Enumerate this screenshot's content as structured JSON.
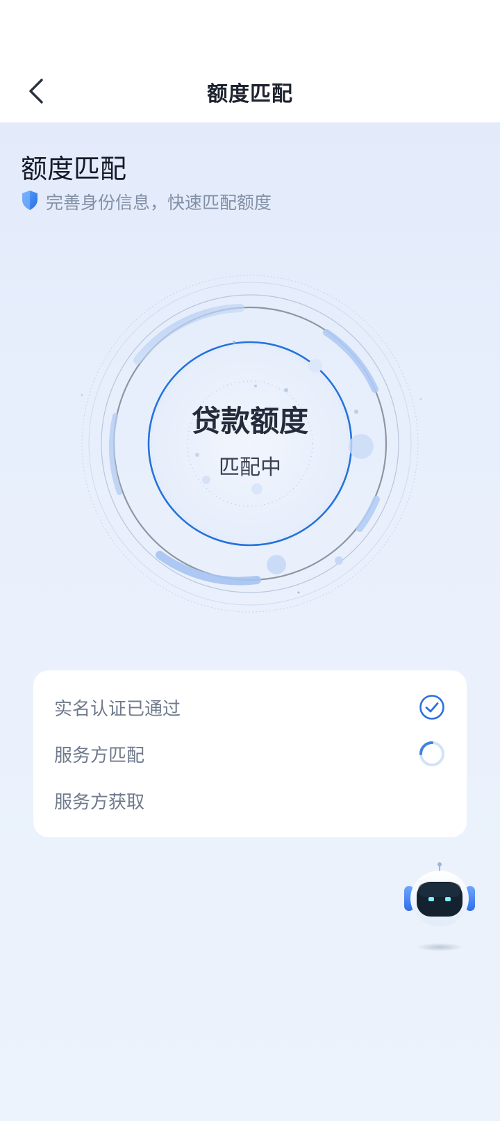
{
  "header": {
    "title": "额度匹配"
  },
  "main": {
    "heading": "额度匹配",
    "subtitle": "完善身份信息，快速匹配额度",
    "ring": {
      "title": "贷款额度",
      "status": "匹配中"
    },
    "steps": [
      {
        "label": "实名认证已通过",
        "state": "done"
      },
      {
        "label": "服务方匹配",
        "state": "loading"
      },
      {
        "label": "服务方获取",
        "state": "pending"
      }
    ]
  },
  "colors": {
    "accent": "#2a6fe0",
    "page_bg": "#eaf1fc",
    "card_bg": "#ffffff"
  },
  "icons": {
    "back": "chevron-left-icon",
    "shield": "shield-icon",
    "check": "check-circle-icon",
    "loading": "loading-spinner-icon",
    "assistant": "robot-assistant-icon"
  }
}
